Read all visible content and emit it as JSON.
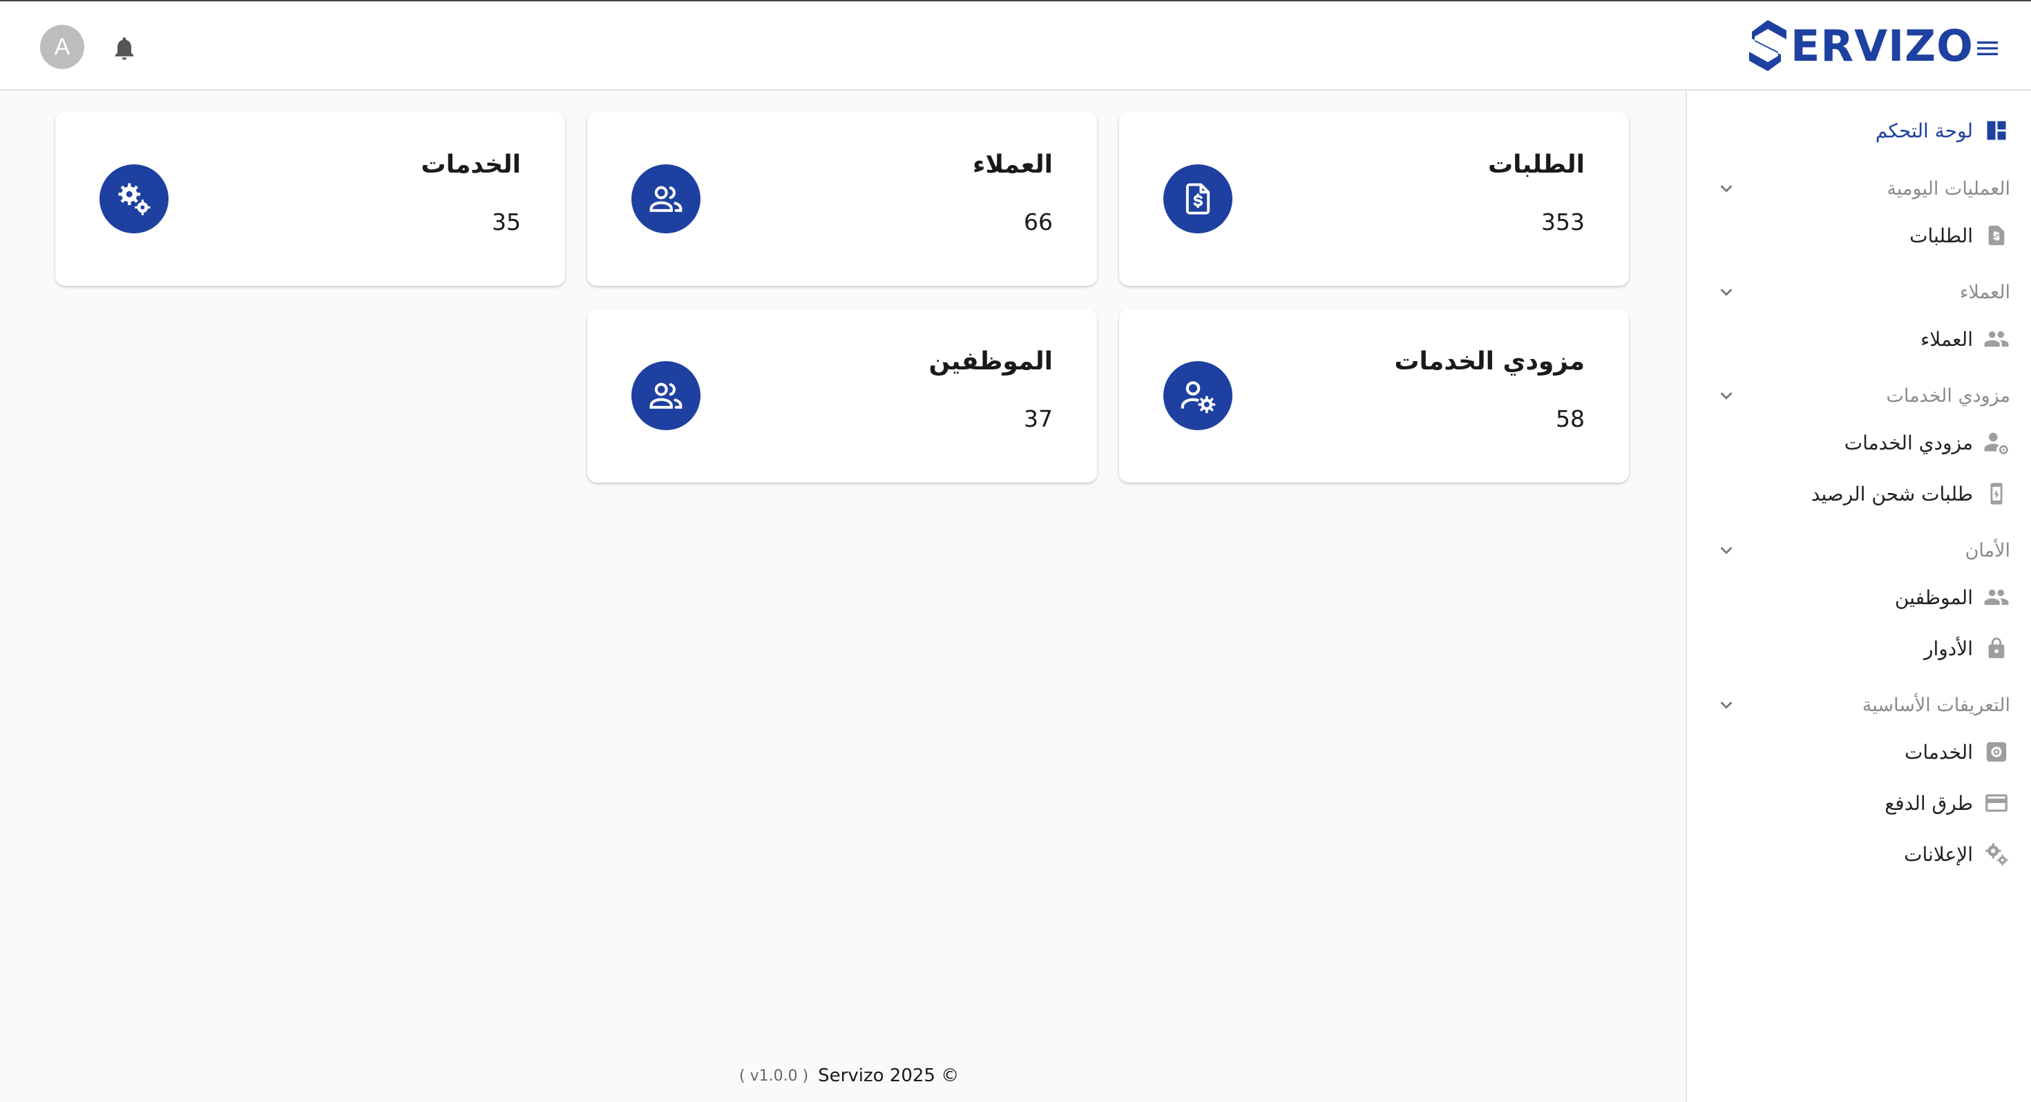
{
  "header": {
    "avatar_letter": "A",
    "bell_icon": "bell-icon",
    "brand": "ERVIZO",
    "brand_color": "#1e40a0",
    "menu_icon": "hamburger-menu-icon"
  },
  "sidebar": {
    "dashboard": "لوحة التحكم",
    "sections": {
      "daily": "العمليات اليومية",
      "customers": "العملاء",
      "providers": "مزودي الخدمات",
      "security": "الأمان",
      "basics": "التعريفات الأساسية"
    },
    "items": {
      "orders": "الطلبات",
      "customers": "العملاء",
      "providers": "مزودي الخدمات",
      "topup_requests": "طلبات شحن الرصيد",
      "employees": "الموظفين",
      "roles": "الأدوار",
      "services": "الخدمات",
      "payment_methods": "طرق الدفع",
      "ads": "الإعلانات"
    }
  },
  "cards": [
    {
      "title": "الطلبات",
      "value": "353",
      "icon": "invoice-dollar-icon"
    },
    {
      "title": "العملاء",
      "value": "66",
      "icon": "users-icon"
    },
    {
      "title": "الخدمات",
      "value": "35",
      "icon": "gears-icon"
    },
    {
      "title": "مزودي الخدمات",
      "value": "58",
      "icon": "user-gear-icon"
    },
    {
      "title": "الموظفين",
      "value": "37",
      "icon": "users-icon"
    }
  ],
  "footer": {
    "version": "( v1.0.0 )",
    "copyright": "Servizo 2025 ©"
  }
}
